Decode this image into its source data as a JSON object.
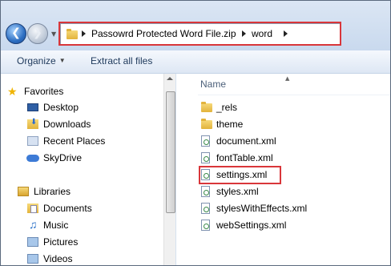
{
  "address_bar": {
    "crumbs": [
      "Passowrd Protected Word File.zip",
      "word"
    ]
  },
  "toolbar": {
    "organize_label": "Organize",
    "extract_label": "Extract all files"
  },
  "nav_pane": {
    "favorites_label": "Favorites",
    "favorites": [
      "Desktop",
      "Downloads",
      "Recent Places",
      "SkyDrive"
    ],
    "libraries_label": "Libraries",
    "libraries": [
      "Documents",
      "Music",
      "Pictures",
      "Videos"
    ]
  },
  "content": {
    "column_name": "Name",
    "files": [
      "_rels",
      "theme",
      "document.xml",
      "fontTable.xml",
      "settings.xml",
      "styles.xml",
      "stylesWithEffects.xml",
      "webSettings.xml"
    ]
  },
  "colors": {
    "highlight": "#d9363a",
    "chrome": "#dbe6f4"
  }
}
